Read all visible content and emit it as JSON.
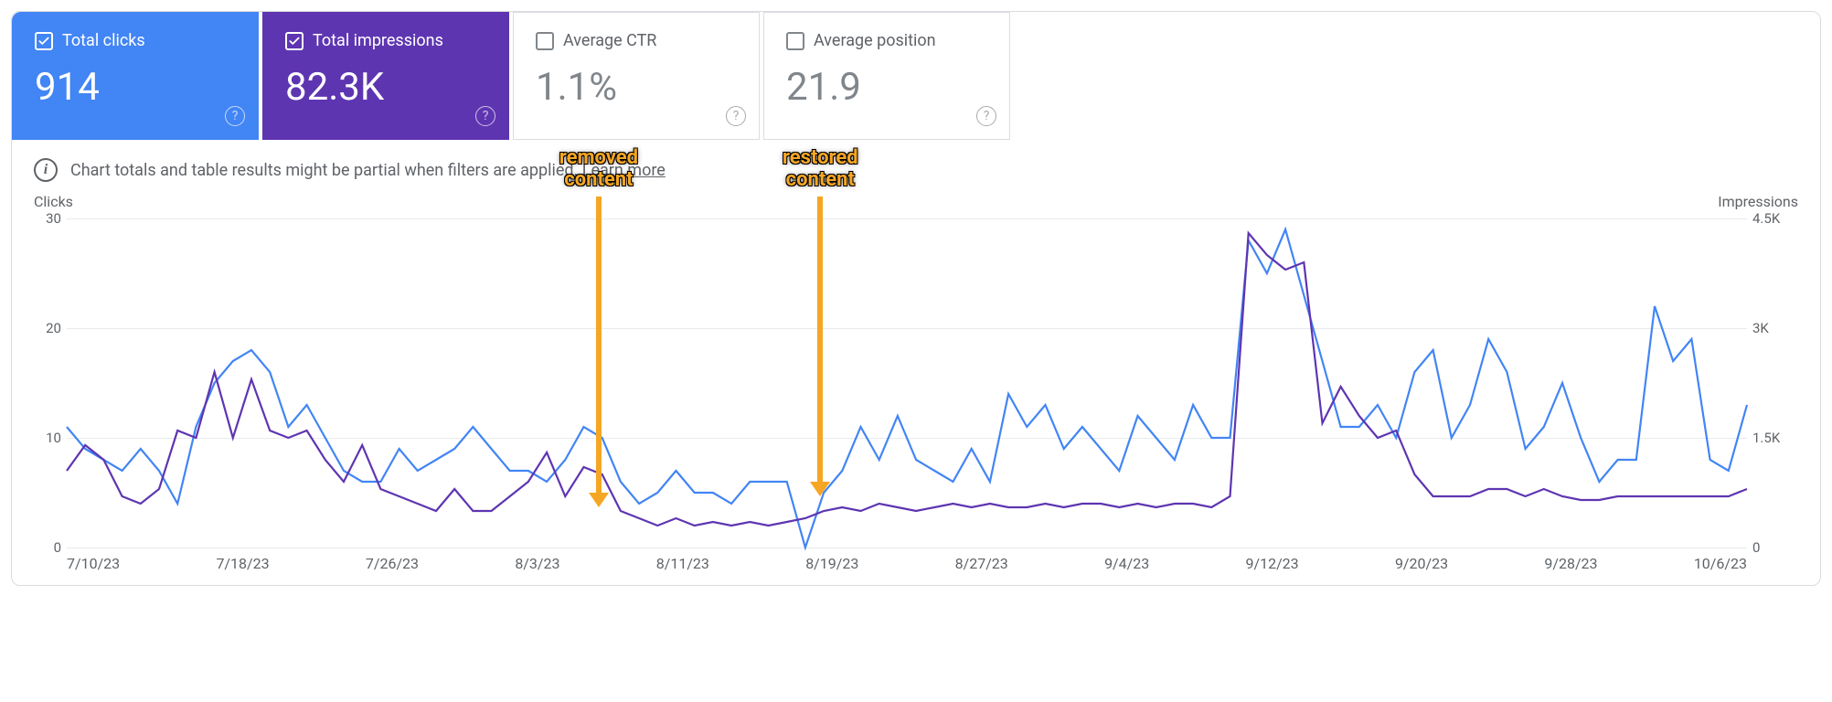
{
  "metrics": {
    "clicks": {
      "label": "Total clicks",
      "value": "914"
    },
    "impressions": {
      "label": "Total impressions",
      "value": "82.3K"
    },
    "ctr": {
      "label": "Average CTR",
      "value": "1.1%"
    },
    "position": {
      "label": "Average position",
      "value": "21.9"
    }
  },
  "notice": {
    "text": "Chart totals and table results might be partial when filters are applied.",
    "link": "Learn more"
  },
  "axes": {
    "left_label": "Clicks",
    "right_label": "Impressions",
    "left_ticks": [
      "30",
      "20",
      "10",
      "0"
    ],
    "right_ticks": [
      "4.5K",
      "3K",
      "1.5K",
      "0"
    ],
    "x_ticks": [
      "7/10/23",
      "7/18/23",
      "7/26/23",
      "8/3/23",
      "8/11/23",
      "8/19/23",
      "8/27/23",
      "9/4/23",
      "9/12/23",
      "9/20/23",
      "9/28/23",
      "10/6/23"
    ]
  },
  "annotations": {
    "removed": {
      "line1": "removed",
      "line2": "content"
    },
    "restored": {
      "line1": "restored",
      "line2": "content"
    }
  },
  "chart_data": {
    "type": "line",
    "xlabel": "",
    "title": "",
    "x": [
      "7/10/23",
      "7/11/23",
      "7/12/23",
      "7/13/23",
      "7/14/23",
      "7/15/23",
      "7/16/23",
      "7/17/23",
      "7/18/23",
      "7/19/23",
      "7/20/23",
      "7/21/23",
      "7/22/23",
      "7/23/23",
      "7/24/23",
      "7/25/23",
      "7/26/23",
      "7/27/23",
      "7/28/23",
      "7/29/23",
      "7/30/23",
      "7/31/23",
      "8/1/23",
      "8/2/23",
      "8/3/23",
      "8/4/23",
      "8/5/23",
      "8/6/23",
      "8/7/23",
      "8/8/23",
      "8/9/23",
      "8/10/23",
      "8/11/23",
      "8/12/23",
      "8/13/23",
      "8/14/23",
      "8/15/23",
      "8/16/23",
      "8/17/23",
      "8/18/23",
      "8/19/23",
      "8/20/23",
      "8/21/23",
      "8/22/23",
      "8/23/23",
      "8/24/23",
      "8/25/23",
      "8/26/23",
      "8/27/23",
      "8/28/23",
      "8/29/23",
      "8/30/23",
      "8/31/23",
      "9/1/23",
      "9/2/23",
      "9/3/23",
      "9/4/23",
      "9/5/23",
      "9/6/23",
      "9/7/23",
      "9/8/23",
      "9/9/23",
      "9/10/23",
      "9/11/23",
      "9/12/23",
      "9/13/23",
      "9/14/23",
      "9/15/23",
      "9/16/23",
      "9/17/23",
      "9/18/23",
      "9/19/23",
      "9/20/23",
      "9/21/23",
      "9/22/23",
      "9/23/23",
      "9/24/23",
      "9/25/23",
      "9/26/23",
      "9/27/23",
      "9/28/23",
      "9/29/23",
      "9/30/23",
      "10/1/23",
      "10/2/23",
      "10/3/23",
      "10/4/23",
      "10/5/23",
      "10/6/23",
      "10/7/23",
      "10/8/23",
      "10/9/23"
    ],
    "series": [
      {
        "name": "Clicks",
        "axis": "left",
        "ylabel": "Clicks",
        "ylim": [
          0,
          30
        ],
        "color": "#4285f4",
        "values": [
          11,
          9,
          8,
          7,
          9,
          7,
          4,
          11,
          15,
          17,
          18,
          16,
          11,
          13,
          10,
          7,
          6,
          6,
          9,
          7,
          8,
          9,
          11,
          9,
          7,
          7,
          6,
          8,
          11,
          10,
          6,
          4,
          5,
          7,
          5,
          5,
          4,
          6,
          6,
          6,
          0,
          5,
          7,
          11,
          8,
          12,
          8,
          7,
          6,
          9,
          6,
          14,
          11,
          13,
          9,
          11,
          9,
          7,
          12,
          10,
          8,
          13,
          10,
          10,
          28,
          25,
          29,
          23,
          17,
          11,
          11,
          13,
          10,
          16,
          18,
          10,
          13,
          19,
          16,
          9,
          11,
          15,
          10,
          6,
          8,
          8,
          22,
          17,
          19,
          8,
          7,
          13
        ]
      },
      {
        "name": "Impressions",
        "axis": "right",
        "ylabel": "Impressions",
        "ylim": [
          0,
          4500
        ],
        "color": "#5e35b1",
        "values": [
          1050,
          1400,
          1200,
          700,
          600,
          800,
          1600,
          1500,
          2400,
          1500,
          2300,
          1600,
          1500,
          1600,
          1200,
          900,
          1400,
          800,
          700,
          600,
          500,
          800,
          500,
          500,
          700,
          900,
          1300,
          700,
          1100,
          1000,
          500,
          400,
          300,
          400,
          300,
          350,
          300,
          350,
          300,
          350,
          400,
          500,
          550,
          500,
          600,
          550,
          500,
          550,
          600,
          550,
          600,
          550,
          550,
          600,
          550,
          600,
          600,
          550,
          600,
          550,
          600,
          600,
          550,
          700,
          4300,
          4000,
          3800,
          3900,
          1700,
          2200,
          1800,
          1500,
          1600,
          1000,
          700,
          700,
          700,
          800,
          800,
          700,
          800,
          700,
          650,
          650,
          700,
          700,
          700,
          700,
          700,
          700,
          700,
          800
        ]
      }
    ],
    "annotations": [
      {
        "x": "8/9/23",
        "text": "removed content"
      },
      {
        "x": "8/21/23",
        "text": "restored content"
      }
    ]
  }
}
